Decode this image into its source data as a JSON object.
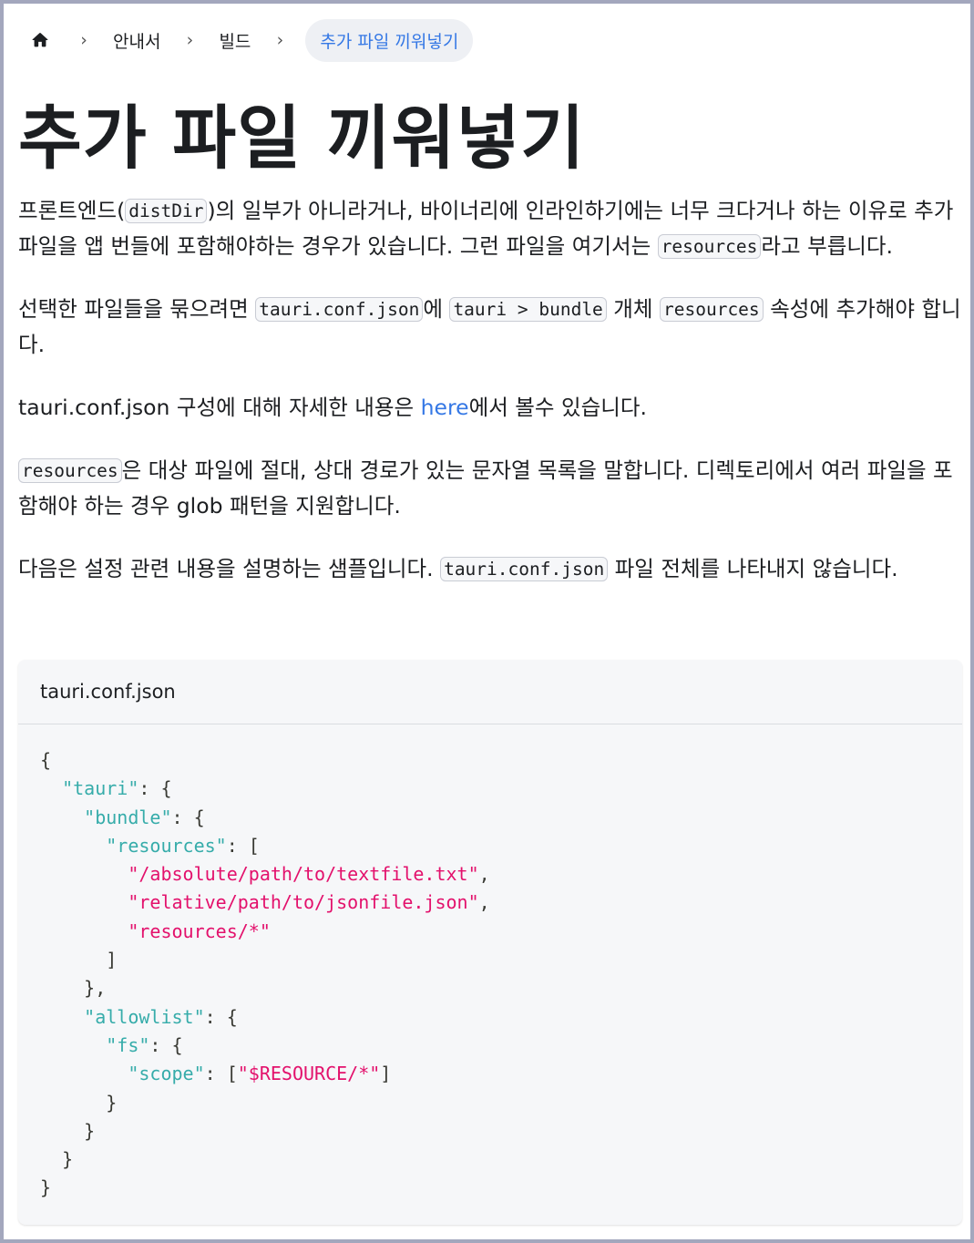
{
  "breadcrumb": {
    "home_icon": "home-icon",
    "separator": "›",
    "items": [
      {
        "label": "안내서"
      },
      {
        "label": "빌드"
      }
    ],
    "current": "추가 파일 끼워넣기"
  },
  "title": "추가 파일 끼워넣기",
  "p1": {
    "a": "프론트엔드(",
    "code1": "distDir",
    "b": ")의 일부가 아니라거나, 바이너리에 인라인하기에는 너무 크다거나 하는 이유로 추가 파일을 앱 번들에 포함해야하는 경우가 있습니다. 그런 파일을 여기서는 ",
    "code2": "resources",
    "c": "라고 부릅니다."
  },
  "p2": {
    "a": "선택한 파일들을 묶으려면 ",
    "code1": "tauri.conf.json",
    "b": "에 ",
    "code2": "tauri > bundle",
    "c": " 개체 ",
    "code3": "resources",
    "d": " 속성에 추가해야 합니다."
  },
  "p3": {
    "a": "tauri.conf.json 구성에 대해 자세한 내용은 ",
    "link": "here",
    "b": "에서 볼수 있습니다."
  },
  "p4": {
    "code1": "resources",
    "a": "은 대상 파일에 절대, 상대 경로가 있는 문자열 목록을 말합니다. 디렉토리에서 여러 파일을 포함해야 하는 경우 glob 패턴을 지원합니다."
  },
  "p5": {
    "a": "다음은 설정 관련 내용을 설명하는 샘플입니다. ",
    "code1": "tauri.conf.json",
    "b": " 파일 전체를 나타내지 않습니다."
  },
  "codeblock": {
    "filename": "tauri.conf.json",
    "tokens": {
      "open": "{",
      "close": "}",
      "key_tauri": "\"tauri\"",
      "key_bundle": "\"bundle\"",
      "key_resources": "\"resources\"",
      "str_1": "\"/absolute/path/to/textfile.txt\"",
      "str_2": "\"relative/path/to/jsonfile.json\"",
      "str_3": "\"resources/*\"",
      "key_allowlist": "\"allowlist\"",
      "key_fs": "\"fs\"",
      "key_scope": "\"scope\"",
      "str_scope": "\"$RESOURCE/*\""
    }
  },
  "colors": {
    "link": "#3578e5",
    "json_key": "#36acaa",
    "json_string": "#e3116c"
  }
}
